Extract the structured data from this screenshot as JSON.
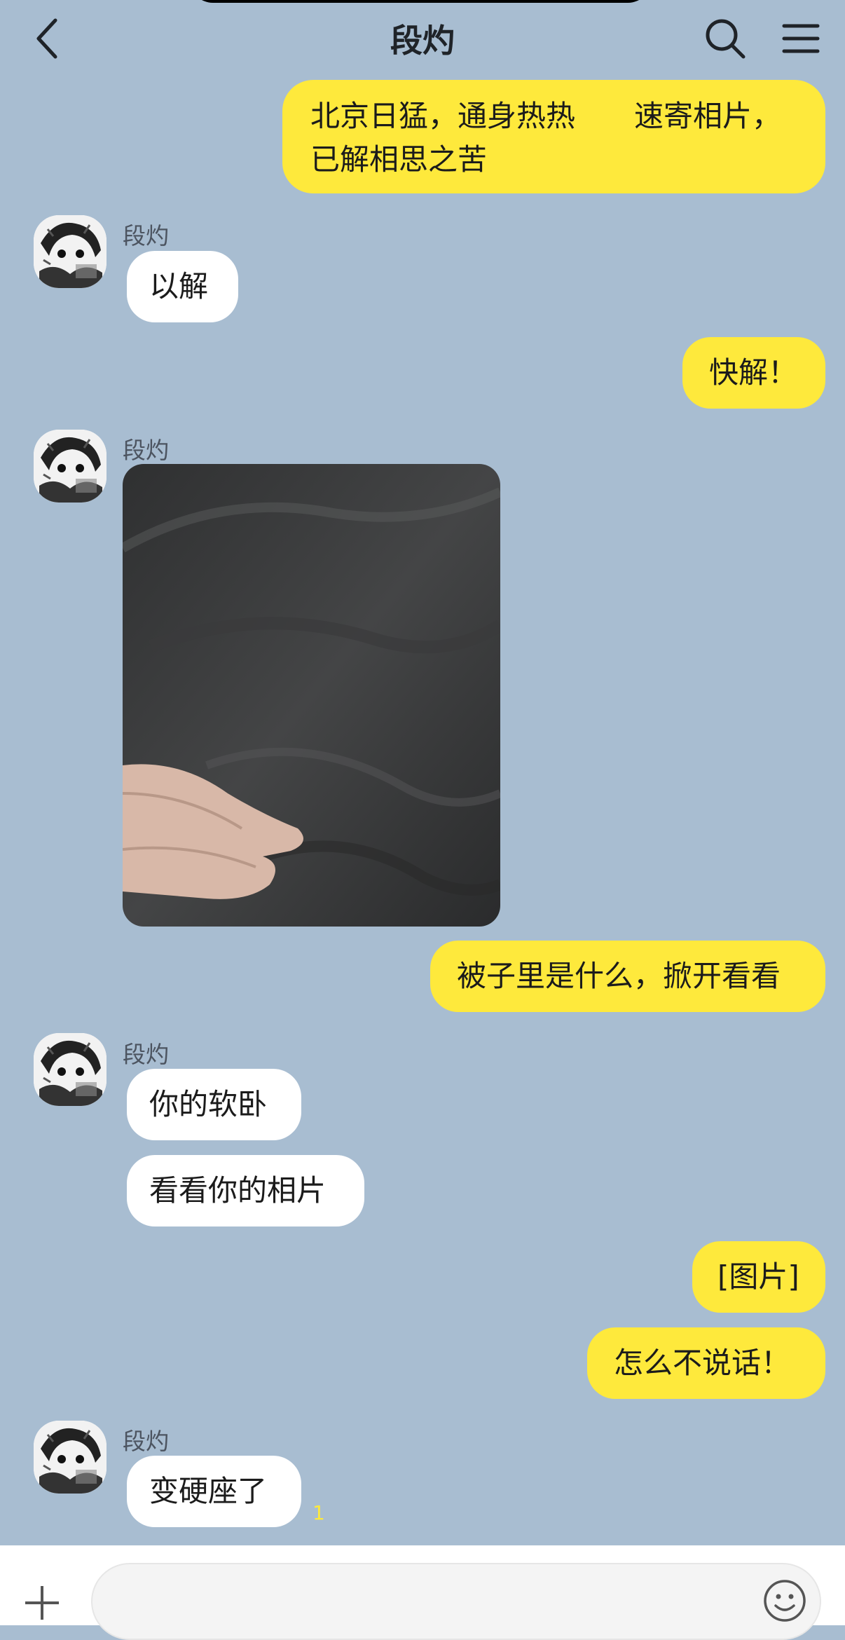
{
  "header": {
    "title": "段灼"
  },
  "messages": [
    {
      "side": "right",
      "text_line1": "北京日猛，通身热热　　速寄相片，",
      "text_line2": "已解相思之苦"
    },
    {
      "side": "left",
      "sender": "段灼",
      "text": "以解"
    },
    {
      "side": "right",
      "text": "快解！"
    },
    {
      "side": "left",
      "sender": "段灼",
      "type": "photo"
    },
    {
      "side": "right",
      "text": "被子里是什么，掀开看看"
    },
    {
      "side": "left",
      "sender": "段灼",
      "text": "你的软卧"
    },
    {
      "side": "left",
      "text": "看看你的相片"
    },
    {
      "side": "right",
      "text": "[图片]"
    },
    {
      "side": "right",
      "text": "怎么不说话！"
    },
    {
      "side": "left",
      "sender": "段灼",
      "text": "变硬座了",
      "unread": "1"
    }
  ],
  "colors": {
    "background": "#a8bdd1",
    "outgoing_bubble": "#fee93c",
    "incoming_bubble": "#ffffff"
  }
}
